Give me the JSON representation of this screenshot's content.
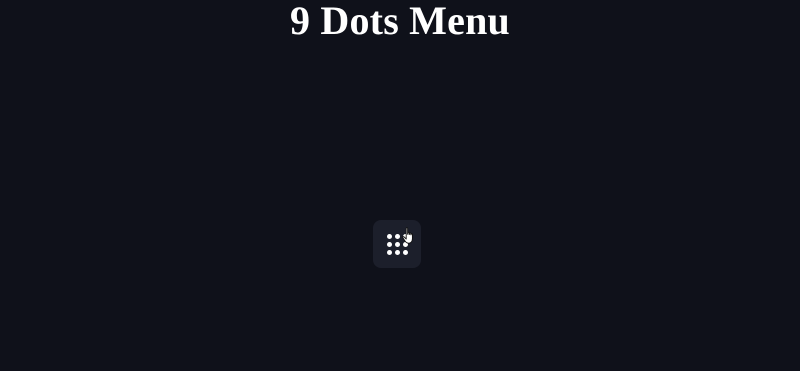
{
  "header": {
    "title": "9 Dots Menu"
  },
  "menu_button": {
    "icon": "nine-dots-icon",
    "dot_count": 9,
    "state": "hover"
  },
  "cursor": {
    "icon": "hand-pointer-icon"
  },
  "colors": {
    "background": "#0f111a",
    "button_background": "#1c1f2b",
    "foreground": "#ffffff"
  }
}
